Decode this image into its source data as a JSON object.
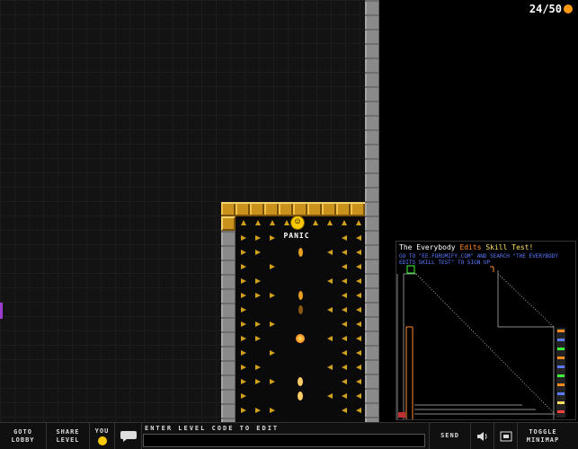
{
  "hud": {
    "coins": "24/50"
  },
  "player": {
    "name": "PANIC"
  },
  "minimap": {
    "title_part1": "The Everybody ",
    "title_part2": "Edits",
    "title_part3": " Skill Test!",
    "info": "GO TO \"EE.FORUMIFY.COM\" AND SEARCH \"THE EVERYBODY EDITS SKILL TEST\" TO SIGN UP"
  },
  "toolbar": {
    "goto_line1": "GOTO",
    "goto_line2": "LOBBY",
    "share_line1": "SHARE",
    "share_line2": "LEVEL",
    "you_label": "YOU",
    "chat_label": "ENTER LEVEL CODE TO EDIT",
    "chat_value": "",
    "send_label": "SEND",
    "toggle_line1": "TOGGLE",
    "toggle_line2": "MINIMAP"
  },
  "icons": [
    "coin-icon",
    "smiley-icon",
    "chat-bubble-icon",
    "sound-icon",
    "fullscreen-icon"
  ],
  "colors": {
    "gold": "#c8921c",
    "stone": "#8a8a8a",
    "coin": "#ff9a10",
    "arrow": "#d4a21a"
  }
}
